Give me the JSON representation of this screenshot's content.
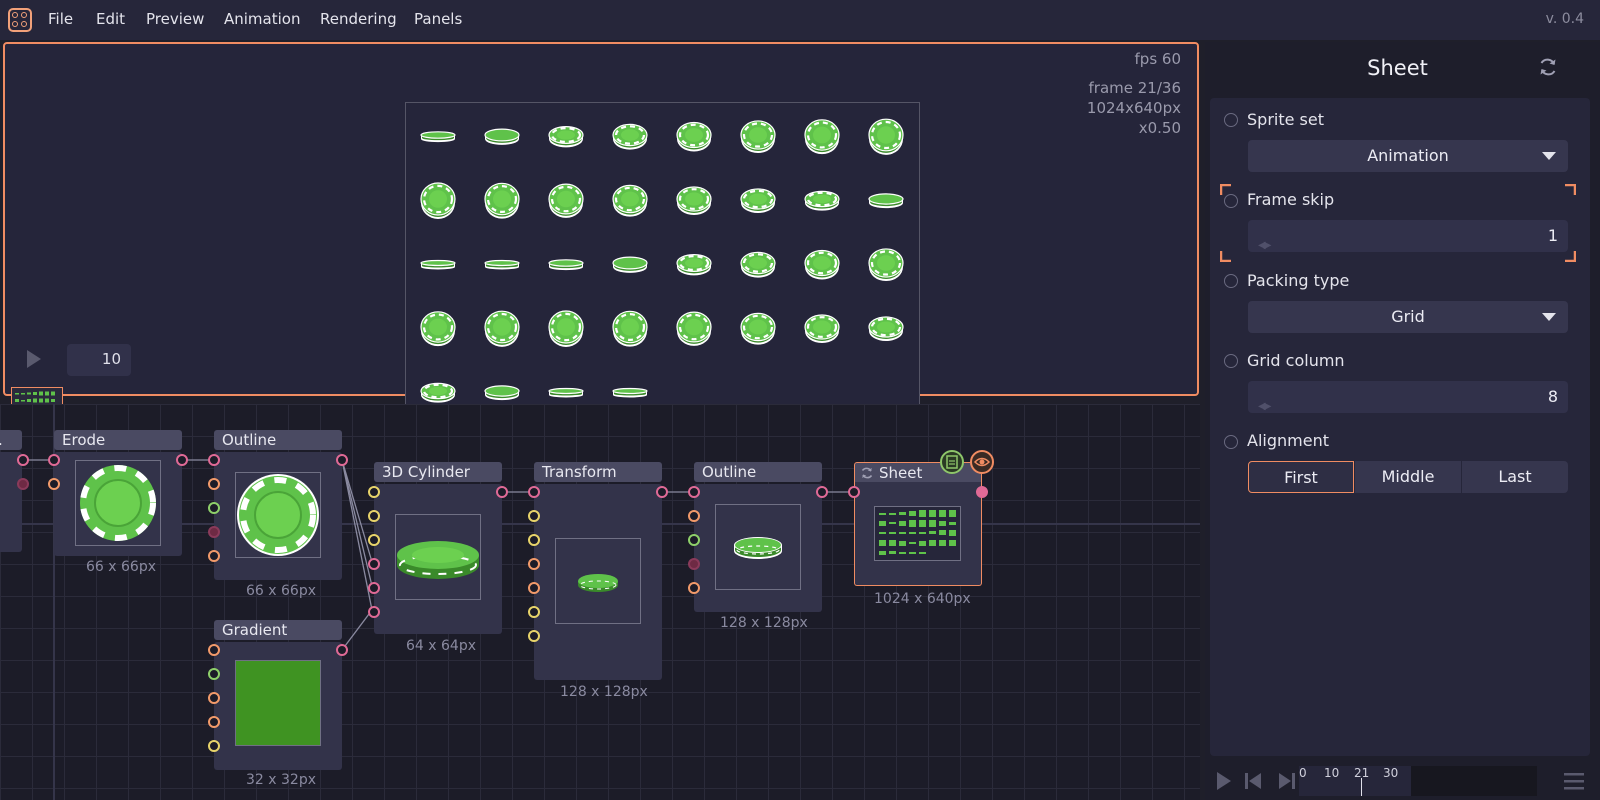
{
  "menubar": {
    "items": [
      "File",
      "Edit",
      "Preview",
      "Animation",
      "Rendering",
      "Panels"
    ],
    "version": "v. 0.4"
  },
  "preview": {
    "fps_label": "fps 60",
    "frame_label": "frame 21/36",
    "size_label": "1024x640px",
    "zoom_label": "x0.50",
    "playback_fps": "10"
  },
  "graph": {
    "nodes": {
      "erode": {
        "title": "Erode",
        "size": "66 x 66px"
      },
      "outline1": {
        "title": "Outline",
        "size": "66 x 66px"
      },
      "gradient": {
        "title": "Gradient",
        "size": "32 x 32px"
      },
      "cylinder": {
        "title": "3D Cylinder",
        "size": "64 x 64px"
      },
      "transform": {
        "title": "Transform",
        "size": "128 x 128px"
      },
      "outline2": {
        "title": "Outline",
        "size": "128 x 128px"
      },
      "sheet": {
        "title": "Sheet",
        "size": "1024 x 640px"
      },
      "partial": {
        "title": "."
      }
    }
  },
  "inspector": {
    "title": "Sheet",
    "sprite_set": {
      "label": "Sprite set",
      "value": "Animation"
    },
    "frame_skip": {
      "label": "Frame skip",
      "value": "1"
    },
    "packing_type": {
      "label": "Packing type",
      "value": "Grid"
    },
    "grid_column": {
      "label": "Grid column",
      "value": "8"
    },
    "alignment": {
      "label": "Alignment",
      "options": [
        "First",
        "Middle",
        "Last"
      ],
      "selected": "First"
    }
  },
  "timeline": {
    "ticks": [
      "0",
      "10",
      "21",
      "30"
    ]
  },
  "colors": {
    "accent": "#f08c62",
    "chip_green": "#5fc24a",
    "chip_dark": "#3a8a2a",
    "background": "#1f1f2a"
  }
}
